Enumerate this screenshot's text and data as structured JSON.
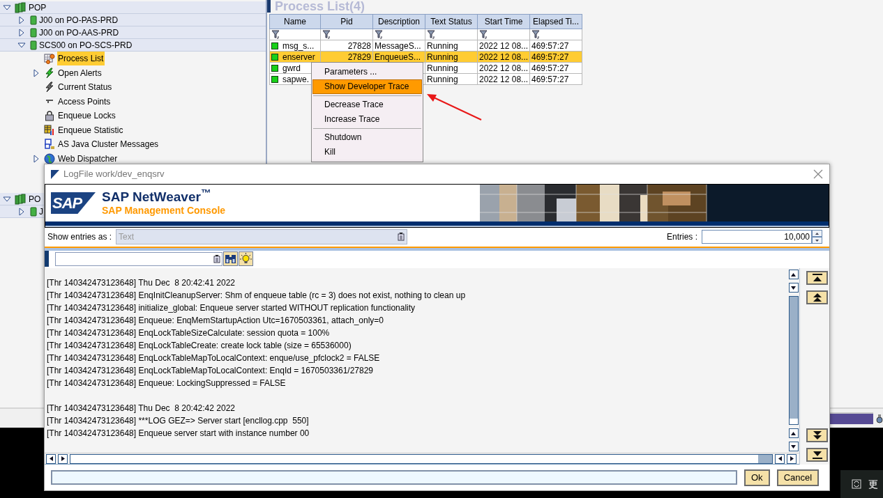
{
  "tree": {
    "nodes": [
      {
        "label": "POP",
        "kind": "system",
        "expanded": true,
        "selected": false,
        "children": [
          {
            "label": "J00 on PO-PAS-PRD",
            "kind": "instance",
            "expanded": false,
            "selected": false
          },
          {
            "label": "J00 on PO-AAS-PRD",
            "kind": "instance",
            "expanded": false,
            "selected": false
          },
          {
            "label": "SCS00 on PO-SCS-PRD",
            "kind": "instance",
            "expanded": true,
            "selected": false,
            "children": [
              {
                "label": "Process List",
                "kind": "process-list",
                "selected": true
              },
              {
                "label": "Open Alerts",
                "kind": "alert",
                "expanded": false,
                "selected": false
              },
              {
                "label": "Current Status",
                "kind": "status",
                "selected": false
              },
              {
                "label": "Access Points",
                "kind": "access",
                "selected": false
              },
              {
                "label": "Enqueue Locks",
                "kind": "lock",
                "selected": false
              },
              {
                "label": "Enqueue Statistic",
                "kind": "statistic",
                "selected": false
              },
              {
                "label": "AS Java Cluster Messages",
                "kind": "messages",
                "selected": false
              },
              {
                "label": "Web Dispatcher",
                "kind": "globe",
                "expanded": false,
                "selected": false
              }
            ]
          }
        ]
      },
      {
        "label": "PO",
        "kind": "system",
        "expanded": true,
        "selected": false,
        "children": [
          {
            "label": "J",
            "kind": "instance",
            "expanded": false,
            "selected": false
          }
        ]
      }
    ]
  },
  "process_list": {
    "title": "Process List(4)",
    "columns": [
      "Name",
      "Pid",
      "Description",
      "Text Status",
      "Start Time",
      "Elapsed Ti..."
    ],
    "rows": [
      {
        "selected": false,
        "name": "msg_s...",
        "pid": "27828",
        "description": "MessageS...",
        "text_status": "Running",
        "start_time": "2022 12 08...",
        "elapsed_time": "469:57:27"
      },
      {
        "selected": true,
        "name": "enserver",
        "pid": "27829",
        "description": "EnqueueS...",
        "text_status": "Running",
        "start_time": "2022 12 08...",
        "elapsed_time": "469:57:27"
      },
      {
        "selected": false,
        "name": "gwrd",
        "text_status": "Running",
        "start_time": "2022 12 08...",
        "elapsed_time": "469:57:27"
      },
      {
        "selected": false,
        "name": "sapwe.",
        "text_status": "Running",
        "start_time": "2022 12 08...",
        "elapsed_time": "469:57:27"
      }
    ]
  },
  "context_menu": {
    "groups": [
      [
        {
          "label": "Parameters ...",
          "selected": false
        },
        {
          "label": "Show Developer Trace",
          "selected": true
        }
      ],
      [
        {
          "label": "Decrease Trace",
          "selected": false
        },
        {
          "label": "Increase Trace",
          "selected": false
        }
      ],
      [
        {
          "label": "Shutdown",
          "selected": false
        },
        {
          "label": "Kill",
          "selected": false
        }
      ]
    ]
  },
  "dialog": {
    "title": "LogFile work/dev_enqsrv",
    "banner": {
      "logo": "SAP",
      "product": "SAP NetWeaver$^{™}$",
      "subtitle": "SAP Management Console"
    },
    "show_entries": {
      "label": "Show entries as :",
      "value": "Text",
      "disabled": true
    },
    "entries": {
      "label": "Entries :",
      "value": "10,000"
    },
    "log": {
      "blocks": [
        [
          "[Thr 140342473123648] Thu Dec  8 20:42:41 2022",
          "[Thr 140342473123648] EnqInitCleanupServer: Shm of enqueue table (rc = 3) does not exist, nothing to clean up",
          "[Thr 140342473123648] initialize_global: Enqueue server started WITHOUT replication functionality",
          "[Thr 140342473123648] Enqueue: EnqMemStartupAction Utc=1670503361, attach_only=0",
          "[Thr 140342473123648] EnqLockTableSizeCalculate: session quota = 100%",
          "[Thr 140342473123648] EnqLockTableCreate: create lock table (size = 65536000)",
          "[Thr 140342473123648] EnqLockTableMapToLocalContext: enque/use_pfclock2 = FALSE",
          "[Thr 140342473123648] EnqLockTableMapToLocalContext: EnqId = 1670503361/27829",
          "[Thr 140342473123648] Enqueue: LockingSuppressed = FALSE"
        ],
        [
          "[Thr 140342473123648] Thu Dec  8 20:42:42 2022",
          "[Thr 140342473123648] ***LOG GEZ=> Server start [encllog.cpp  550]",
          "[Thr 140342473123648] Enqueue server start with instance number 00"
        ]
      ]
    },
    "buttons": [
      {
        "label": "Ok"
      },
      {
        "label": "Cancel"
      }
    ]
  },
  "corner_panel": {
    "text": "更"
  }
}
